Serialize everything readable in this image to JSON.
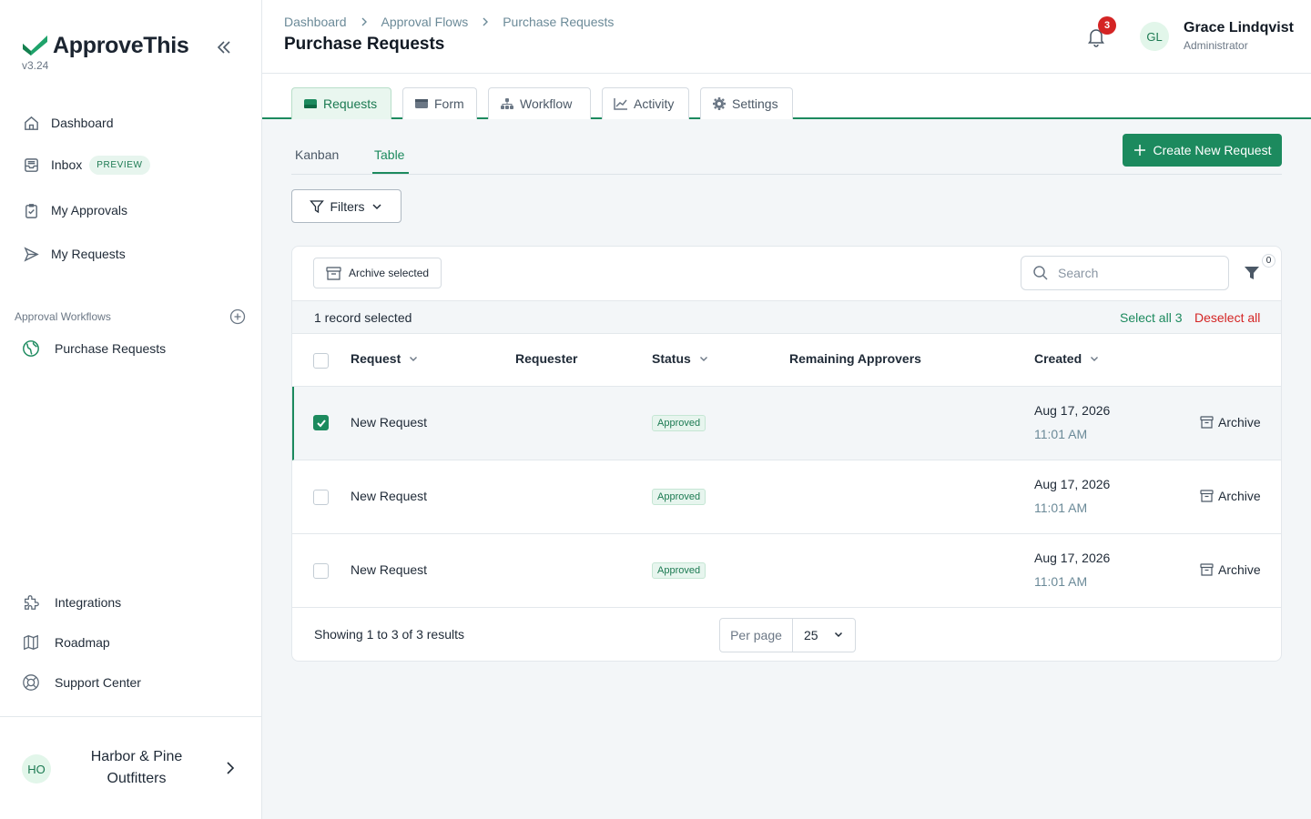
{
  "brand": {
    "name": "ApproveThis",
    "version": "v3.24"
  },
  "nav": {
    "dashboard": "Dashboard",
    "inbox": "Inbox",
    "inbox_badge": "PREVIEW",
    "my_approvals": "My Approvals",
    "my_requests": "My Requests"
  },
  "workflows": {
    "section_title": "Approval Workflows",
    "items": [
      "Purchase Requests"
    ]
  },
  "bottom_nav": {
    "integrations": "Integrations",
    "roadmap": "Roadmap",
    "support": "Support Center"
  },
  "org": {
    "initials": "HO",
    "name": "Harbor & Pine Outfitters"
  },
  "header": {
    "breadcrumb": [
      "Dashboard",
      "Approval Flows",
      "Purchase Requests"
    ],
    "title": "Purchase Requests",
    "notification_count": "3",
    "user": {
      "initials": "GL",
      "name": "Grace Lindqvist",
      "role": "Administrator"
    }
  },
  "tabs": [
    "Requests",
    "Form",
    "Workflow",
    "Activity",
    "Settings"
  ],
  "active_tab": "Requests",
  "subtabs": [
    "Kanban",
    "Table"
  ],
  "active_subtab": "Table",
  "create_button": "Create New Request",
  "filters_button": "Filters",
  "table": {
    "archive_selected": "Archive selected",
    "search_placeholder": "Search",
    "filter_count": "0",
    "selection_text": "1 record selected",
    "select_all": "Select all 3",
    "deselect_all": "Deselect all",
    "columns": [
      "Request",
      "Requester",
      "Status",
      "Remaining Approvers",
      "Created"
    ],
    "rows": [
      {
        "request": "New Request",
        "requester": "",
        "status": "Approved",
        "remaining": "",
        "date": "Aug 17, 2026",
        "time": "11:01 AM",
        "action": "Archive",
        "selected": true
      },
      {
        "request": "New Request",
        "requester": "",
        "status": "Approved",
        "remaining": "",
        "date": "Aug 17, 2026",
        "time": "11:01 AM",
        "action": "Archive",
        "selected": false
      },
      {
        "request": "New Request",
        "requester": "",
        "status": "Approved",
        "remaining": "",
        "date": "Aug 17, 2026",
        "time": "11:01 AM",
        "action": "Archive",
        "selected": false
      }
    ],
    "footer_text": "Showing 1 to 3 of 3 results",
    "per_page_label": "Per page",
    "per_page_value": "25"
  },
  "colors": {
    "accent": "#1c8a5e",
    "danger": "#d42424",
    "badge_bg": "#e7f5ee"
  }
}
